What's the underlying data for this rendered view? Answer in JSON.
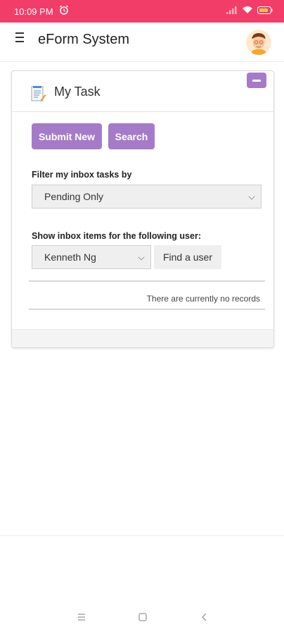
{
  "status_bar": {
    "time": "10:09 PM",
    "icons": [
      "alarm-icon",
      "signal-icon",
      "wifi-icon",
      "battery-icon"
    ]
  },
  "app_bar": {
    "title": "eForm System",
    "menu_icon": "hamburger-menu-icon",
    "avatar": "user-avatar"
  },
  "card": {
    "title": "My Task",
    "icon": "document-icon",
    "collapse_icon": "minus-icon",
    "buttons": {
      "submit_new": "Submit New",
      "search": "Search"
    },
    "filter": {
      "label": "Filter my inbox tasks by",
      "selected": "Pending Only"
    },
    "user_filter": {
      "label": "Show inbox items for the following user:",
      "selected": "Kenneth Ng",
      "find_button": "Find a user"
    },
    "empty_message": "There are currently no records"
  },
  "nav_bar": {
    "icons": [
      "recents-icon",
      "home-icon",
      "back-icon"
    ]
  },
  "colors": {
    "status_bar": "#f33d69",
    "accent": "#a57bc9",
    "control_bg": "#efefef"
  }
}
